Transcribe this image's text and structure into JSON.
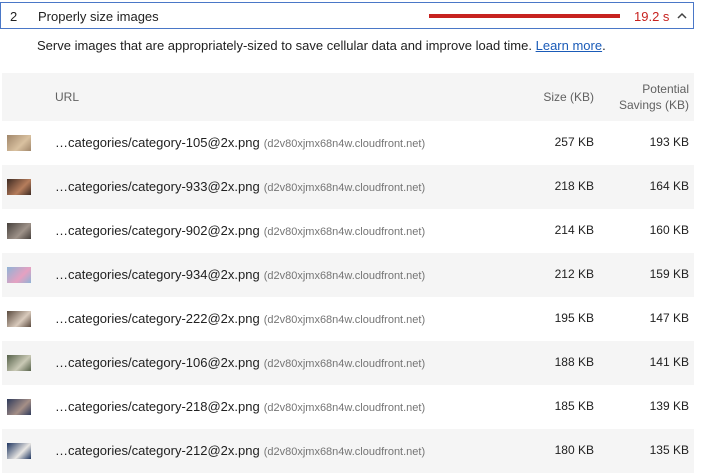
{
  "audit": {
    "index": "2",
    "title": "Properly size images",
    "value": "19.2 s",
    "description": "Serve images that are appropriately-sized to save cellular data and improve load time.",
    "learn_more": "Learn more",
    "period": ".",
    "bar_color": "#c7221f"
  },
  "table": {
    "columns": {
      "url": "URL",
      "size": "Size (KB)",
      "savings_line1": "Potential",
      "savings_line2": "Savings (KB)"
    },
    "rows": [
      {
        "url": "…categories/category-105@2x.png",
        "host": "(d2v80xjmx68n4w.cloudfront.net)",
        "size": "257 KB",
        "savings": "193 KB",
        "thumb": [
          "#a0866a",
          "#d9c1a0"
        ]
      },
      {
        "url": "…categories/category-933@2x.png",
        "host": "(d2v80xjmx68n4w.cloudfront.net)",
        "size": "218 KB",
        "savings": "164 KB",
        "thumb": [
          "#3d2a22",
          "#b67d5c"
        ]
      },
      {
        "url": "…categories/category-902@2x.png",
        "host": "(d2v80xjmx68n4w.cloudfront.net)",
        "size": "214 KB",
        "savings": "160 KB",
        "thumb": [
          "#46403c",
          "#9e9289"
        ]
      },
      {
        "url": "…categories/category-934@2x.png",
        "host": "(d2v80xjmx68n4w.cloudfront.net)",
        "size": "212 KB",
        "savings": "159 KB",
        "thumb": [
          "#8fb3d6",
          "#e6a1c1"
        ]
      },
      {
        "url": "…categories/category-222@2x.png",
        "host": "(d2v80xjmx68n4w.cloudfront.net)",
        "size": "195 KB",
        "savings": "147 KB",
        "thumb": [
          "#5a4a3e",
          "#d9cabc"
        ]
      },
      {
        "url": "…categories/category-106@2x.png",
        "host": "(d2v80xjmx68n4w.cloudfront.net)",
        "size": "188 KB",
        "savings": "141 KB",
        "thumb": [
          "#556149",
          "#c9c9b5"
        ]
      },
      {
        "url": "…categories/category-218@2x.png",
        "host": "(d2v80xjmx68n4w.cloudfront.net)",
        "size": "185 KB",
        "savings": "139 KB",
        "thumb": [
          "#2e3a5a",
          "#a58f87"
        ]
      },
      {
        "url": "…categories/category-212@2x.png",
        "host": "(d2v80xjmx68n4w.cloudfront.net)",
        "size": "180 KB",
        "savings": "135 KB",
        "thumb": [
          "#1e3560",
          "#e8e6e3"
        ]
      }
    ]
  },
  "icons": {
    "chevron": "chevron-up-icon"
  }
}
